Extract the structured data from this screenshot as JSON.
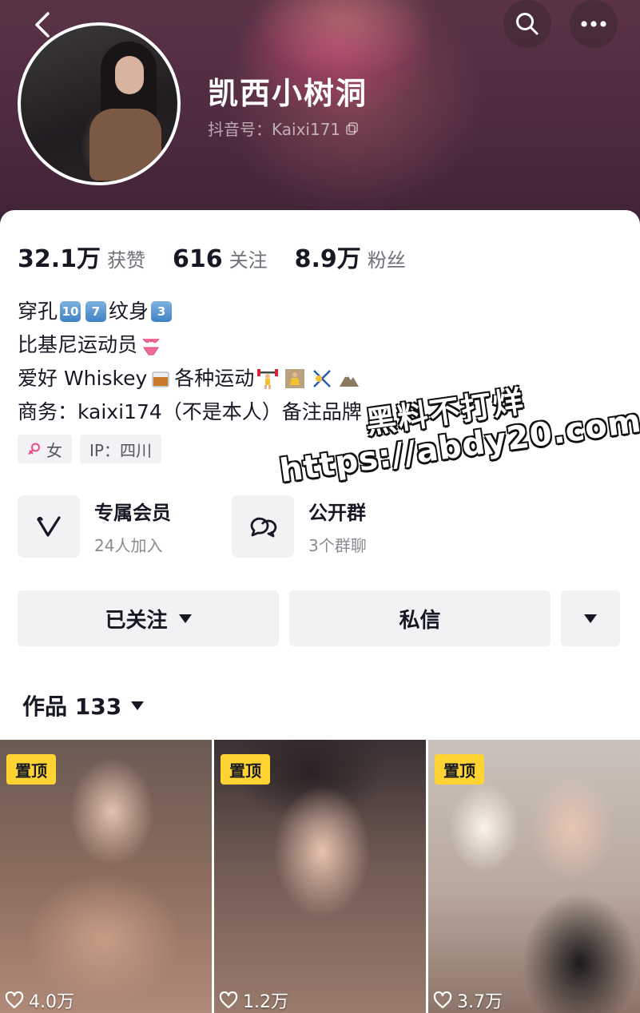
{
  "header": {
    "nickname": "凯西小树洞",
    "douyin_id": "抖音号：Kaixi171"
  },
  "stats": [
    {
      "value": "32.1万",
      "label": "获赞"
    },
    {
      "value": "616",
      "label": "关注"
    },
    {
      "value": "8.9万",
      "label": "粉丝"
    }
  ],
  "bio": {
    "line1_a": "穿孔",
    "line1_key1": "10",
    "line1_key2": "7",
    "line1_b": "纹身",
    "line1_key3": "3",
    "line2": "比基尼运动员",
    "line3_a": "爱好 Whiskey",
    "line3_b": "各种运动",
    "line4": "商务：kaixi174（不是本人）备注品牌"
  },
  "tags": {
    "gender": "女",
    "ip": "IP：四川"
  },
  "features": [
    {
      "title": "专属会员",
      "sub": "24人加入"
    },
    {
      "title": "公开群",
      "sub": "3个群聊"
    }
  ],
  "actions": {
    "followed": "已关注",
    "message": "私信"
  },
  "works": {
    "label": "作品 133"
  },
  "videos": [
    {
      "badge": "置顶",
      "likes": "4.0万"
    },
    {
      "badge": "置顶",
      "likes": "1.2万"
    },
    {
      "badge": "置顶",
      "likes": "3.7万"
    }
  ],
  "watermark": {
    "line1": "黑料不打烊",
    "line2": "https://abdy20.com"
  },
  "colors": {
    "banner": "#4d2a40",
    "pin_badge": "#fed332",
    "button_bg": "#f2f2f4",
    "gender_icon": "#e84a8a"
  }
}
